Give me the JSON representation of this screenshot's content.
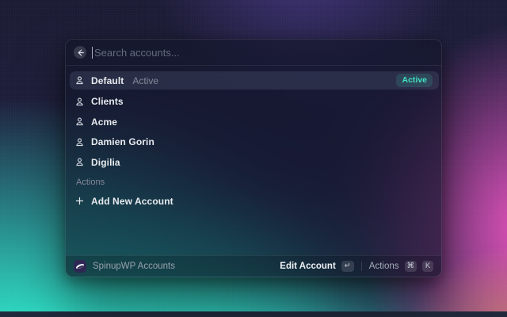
{
  "app": {
    "search_placeholder": "Search accounts...",
    "accounts": [
      {
        "name": "Default",
        "subtitle": "Active",
        "badge": "Active"
      },
      {
        "name": "Clients"
      },
      {
        "name": "Acme"
      },
      {
        "name": "Damien Gorin"
      },
      {
        "name": "Digilia"
      }
    ],
    "actions_section_label": "Actions",
    "add_account_label": "Add New Account",
    "footer": {
      "app_name": "SpinupWP Accounts",
      "edit_label": "Edit Account",
      "enter_key": "↵",
      "actions_label": "Actions",
      "cmd_key": "⌘",
      "k_key": "K"
    },
    "colors": {
      "accent_teal": "#41e2c2",
      "wallpaper_teal": "#2df2d1",
      "wallpaper_pink": "#ec52c0",
      "wallpaper_purple": "#6048b2"
    }
  }
}
